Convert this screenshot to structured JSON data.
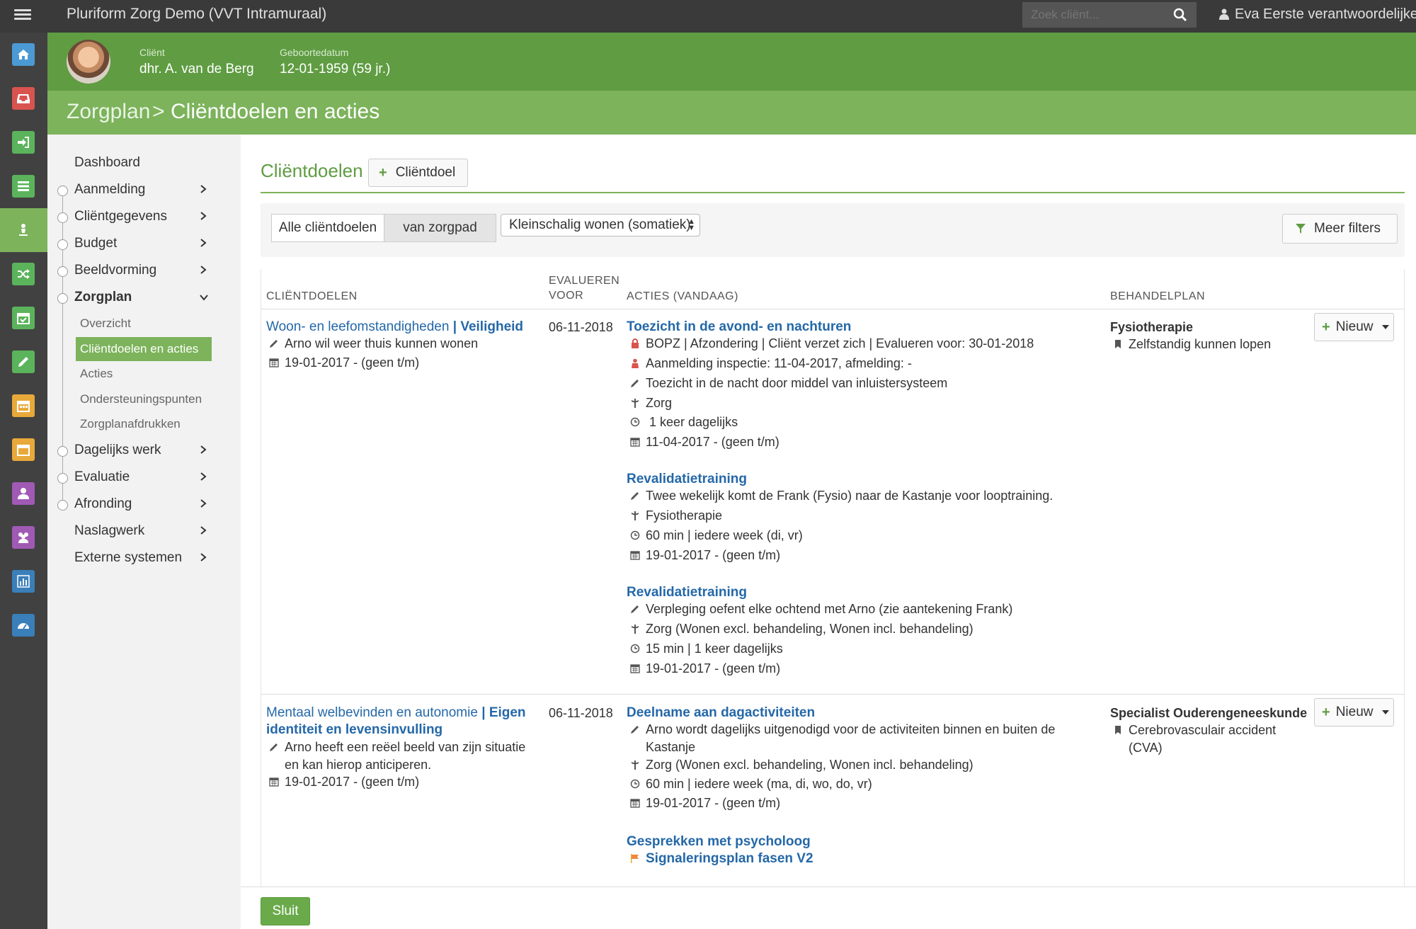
{
  "app": {
    "title": "Pluriform Zorg Demo  (VVT Intramuraal)",
    "search_placeholder": "Zoek cliënt...",
    "user": "Eva Eerste verantwoordelijke"
  },
  "client": {
    "label_client": "Cliënt",
    "name": "dhr. A. van de Berg",
    "label_dob": "Geboortedatum",
    "dob": "12-01-1959 (59 jr.)"
  },
  "breadcrumb": {
    "parent": "Zorgplan",
    "separator": ">",
    "current": "Cliëntdoelen en acties"
  },
  "rail_colors": [
    "#4b9ad3",
    "#d9534f",
    "#5bb35b",
    "#5bb35b",
    "#ffffff",
    "#5bb35b",
    "#5bb35b",
    "#5bb35b",
    "#e8a93a",
    "#e8a93a",
    "#a05ab4",
    "#a05ab4",
    "#3a7fb9",
    "#3a7fb9"
  ],
  "nav": {
    "items": [
      "Dashboard",
      "Aanmelding",
      "Cliëntgegevens",
      "Budget",
      "Beeldvorming",
      "Zorgplan",
      "Dagelijks werk",
      "Evaluatie",
      "Afronding",
      "Naslagwerk",
      "Externe systemen"
    ],
    "sub": [
      "Overzicht",
      "Cliëntdoelen en acties",
      "Acties",
      "Ondersteuningspunten",
      "Zorgplanafdrukken"
    ]
  },
  "section": {
    "title": "Cliëntdoelen",
    "add_button": "Cliëntdoel"
  },
  "filters": {
    "all": "Alle cliëntdoelen",
    "pathway": "van zorgpad",
    "select_value": "Kleinschalig wonen (somatiek)",
    "more": "Meer filters"
  },
  "table": {
    "headers": {
      "goals": "CLIËNTDOELEN",
      "evaluate1": "EVALUEREN",
      "evaluate2": "VOOR",
      "actions": "ACTIES (VANDAAG)",
      "plan": "BEHANDELPLAN"
    },
    "rows": [
      {
        "goal_part1": "Woon- en leefomstandigheden",
        "goal_sep": " | ",
        "goal_part2": "Veiligheid",
        "goal_desc": "Arno wil weer thuis kunnen wonen",
        "goal_date": "19-01-2017 - (geen t/m)",
        "evaluate": "06-11-2018",
        "actions": [
          {
            "title": "Toezicht in de avond- en nachturen",
            "lines": [
              "BOPZ | Afzondering | Cliënt verzet zich | Evalueren voor: 30-01-2018",
              "Aanmelding inspectie: 11-04-2017, afmelding: -",
              "Toezicht in de nacht door middel van inluistersysteem",
              "Zorg",
              " 1 keer dagelijks",
              "11-04-2017 - (geen t/m)"
            ]
          },
          {
            "title": "Revalidatietraining",
            "lines": [
              "Twee wekelijk komt de Frank (Fysio) naar de Kastanje voor looptraining.",
              "Fysiotherapie",
              "60 min | iedere week (di, vr)",
              "19-01-2017 - (geen t/m)"
            ]
          },
          {
            "title": "Revalidatietraining",
            "lines": [
              "Verpleging oefent elke ochtend met Arno (zie aantekening Frank)",
              "Zorg (Wonen excl. behandeling, Wonen incl. behandeling)",
              "15 min | 1 keer dagelijks",
              "19-01-2017 - (geen t/m)"
            ]
          }
        ],
        "plan_title": "Fysiotherapie",
        "plan_item": "Zelfstandig kunnen lopen",
        "new_button": "Nieuw"
      },
      {
        "goal_part1": "Mentaal welbevinden en autonomie",
        "goal_sep": " | ",
        "goal_part2a": "Eigen",
        "goal_part2b": "identiteit en levensinvulling",
        "goal_desc1": "Arno heeft een reëel beeld van zijn situatie",
        "goal_desc2": "en kan hierop anticiperen.",
        "goal_date": "19-01-2017 - (geen t/m)",
        "evaluate": "06-11-2018",
        "actions": [
          {
            "title": "Deelname aan dagactiviteiten",
            "lines": [
              "Arno wordt dagelijks uitgenodigd voor de activiteiten binnen en buiten de",
              "Kastanje",
              "Zorg (Wonen excl. behandeling, Wonen incl. behandeling)",
              "60 min | iedere week (ma, di, wo, do, vr)",
              "19-01-2017 - (geen t/m)"
            ]
          },
          {
            "title": "Gesprekken met psycholoog",
            "lines": [
              "Signaleringsplan fasen V2"
            ]
          }
        ],
        "plan_title": "Specialist Ouderengeneeskunde",
        "plan_item1": "Cerebrovasculair accident",
        "plan_item2": "(CVA)",
        "new_button": "Nieuw"
      }
    ]
  },
  "footer": {
    "close": "Sluit"
  }
}
